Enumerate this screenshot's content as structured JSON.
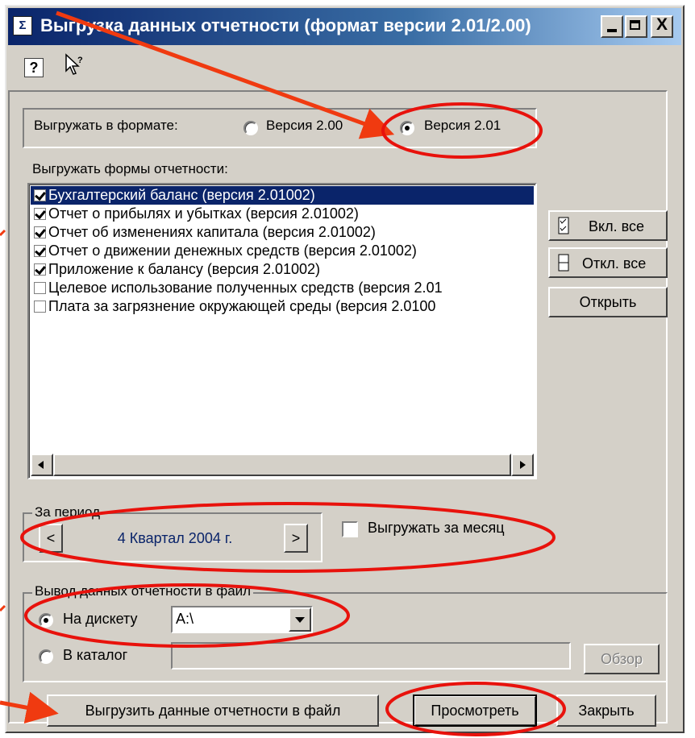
{
  "window": {
    "title": "Выгрузка данных отчетности (формат версии 2.01/2.00)",
    "close_glyph": "X"
  },
  "toolbar": {
    "help_glyph": "?"
  },
  "format": {
    "label": "Выгружать в формате:",
    "options": [
      {
        "label": "Версия 2.00",
        "selected": false
      },
      {
        "label": "Версия 2.01",
        "selected": true
      }
    ]
  },
  "forms": {
    "label": "Выгружать формы отчетности:",
    "items": [
      {
        "label": "Бухгалтерский баланс (версия 2.01002)",
        "checked": true,
        "selected": true
      },
      {
        "label": "Отчет о прибылях и убытках (версия 2.01002)",
        "checked": true,
        "selected": false
      },
      {
        "label": "Отчет об изменениях капитала (версия 2.01002)",
        "checked": true,
        "selected": false
      },
      {
        "label": "Отчет о движении денежных средств (версия 2.01002)",
        "checked": true,
        "selected": false
      },
      {
        "label": "Приложение к балансу (версия 2.01002)",
        "checked": true,
        "selected": false
      },
      {
        "label": "Целевое использование полученных средств (версия 2.01",
        "checked": false,
        "selected": false
      },
      {
        "label": "Плата за загрязнение окружающей среды (версия 2.0100",
        "checked": false,
        "selected": false
      }
    ]
  },
  "side_buttons": {
    "check_all": "Вкл. все",
    "uncheck_all": "Откл. все",
    "open": "Открыть"
  },
  "period": {
    "group_label": "За период",
    "prev_glyph": "<",
    "next_glyph": ">",
    "value": "4 Квартал 2004 г.",
    "monthly_label": "Выгружать за месяц",
    "monthly_checked": false
  },
  "output": {
    "group_label": "Вывод данных отчетности в файл",
    "to_floppy_label": "На дискету",
    "to_floppy_selected": true,
    "drive_value": "A:\\",
    "to_folder_label": "В каталог",
    "folder_value": "",
    "browse_label": "Обзор"
  },
  "actions": {
    "export": "Выгрузить данные отчетности в файл",
    "preview": "Просмотреть",
    "close": "Закрыть"
  },
  "annotation_colors": {
    "ellipse": "#e8120c",
    "arrow": "#f03a10"
  }
}
